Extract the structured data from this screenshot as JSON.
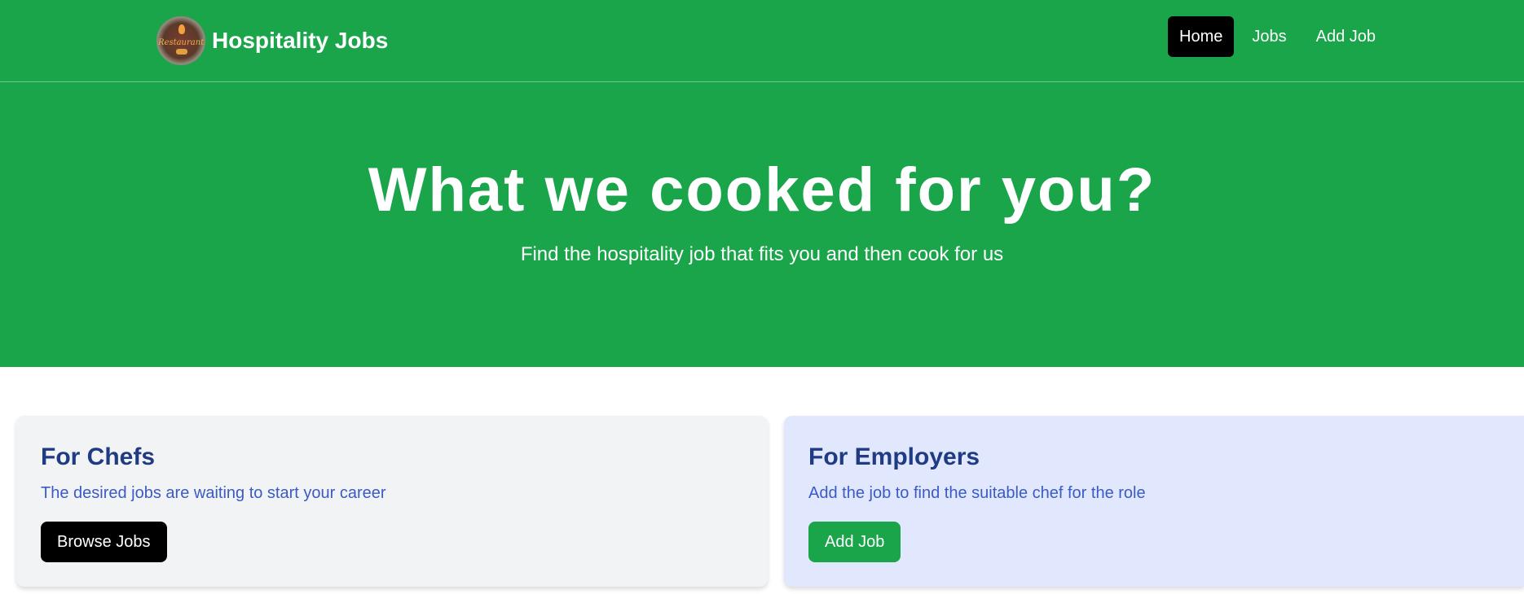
{
  "header": {
    "brand_name": "Hospitality Jobs",
    "logo_text": "Restaurant",
    "nav": [
      {
        "label": "Home",
        "active": true
      },
      {
        "label": "Jobs",
        "active": false
      },
      {
        "label": "Add Job",
        "active": false
      }
    ]
  },
  "hero": {
    "title": "What we cooked for you?",
    "subtitle": "Find the hospitality job that fits you and then cook for us"
  },
  "cards": {
    "chefs": {
      "title": "For Chefs",
      "description": "The desired jobs are waiting to start your career",
      "button": "Browse Jobs"
    },
    "employers": {
      "title": "For Employers",
      "description": "Add the job to find the suitable chef for the role",
      "button": "Add Job"
    }
  },
  "colors": {
    "brand_green": "#1aa54b",
    "heading_blue": "#1f3b84",
    "text_blue": "#3a5bc7",
    "employer_card_bg": "#e1e7fd",
    "chef_card_bg": "#f2f3f5"
  }
}
